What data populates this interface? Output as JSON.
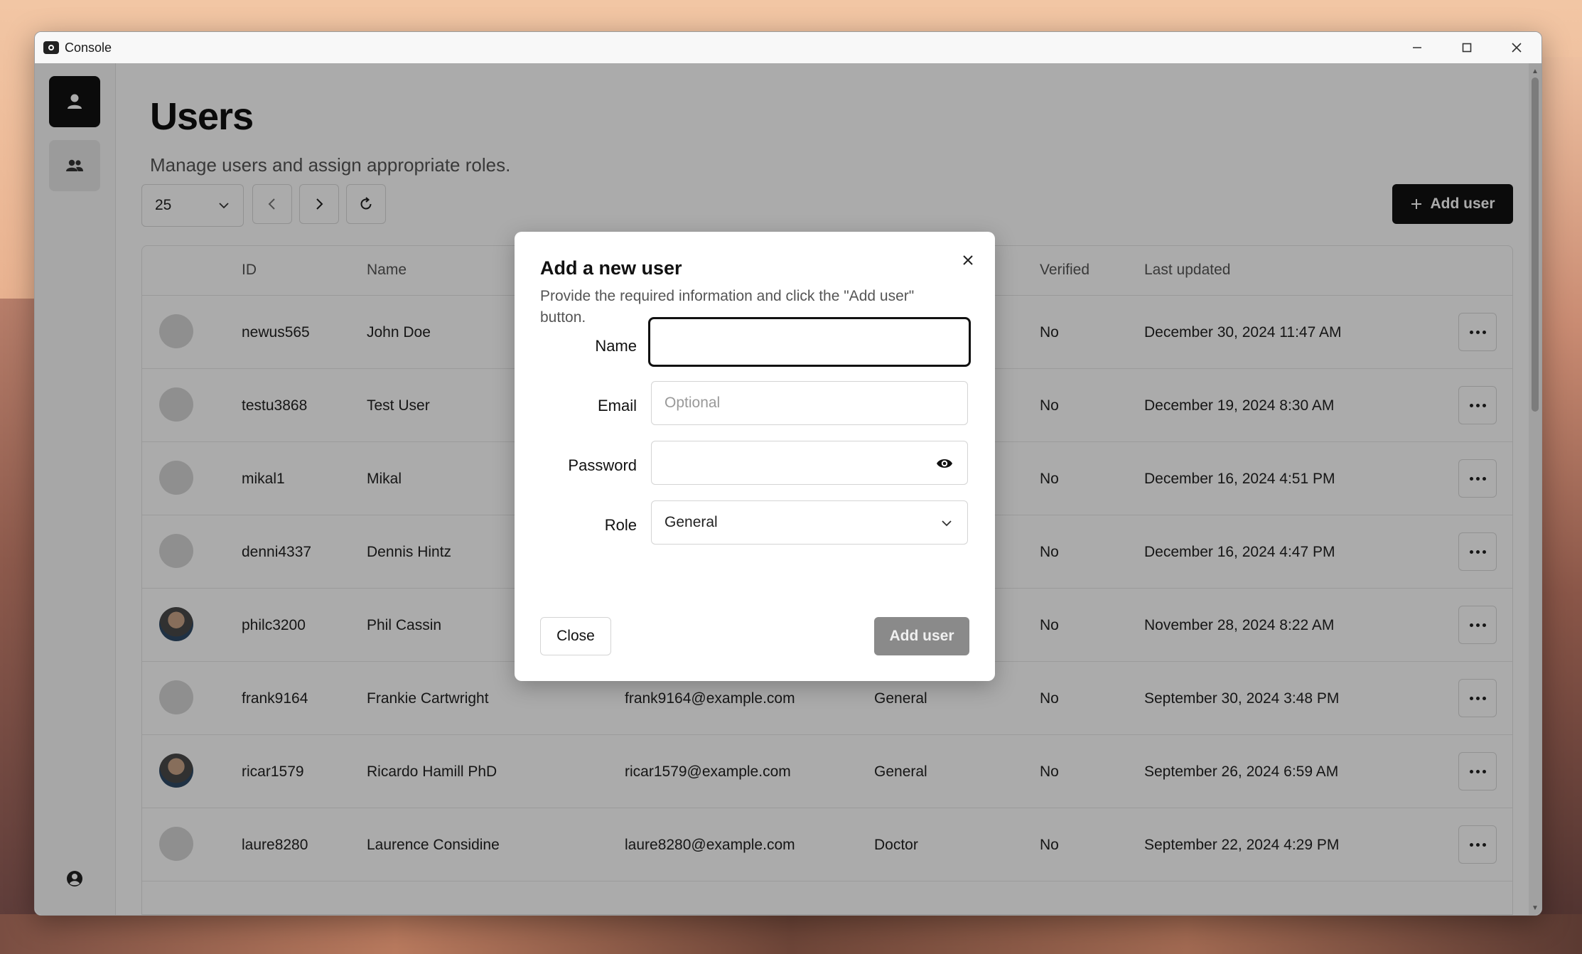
{
  "window": {
    "title": "Console"
  },
  "page": {
    "title": "Users",
    "subtitle": "Manage users and assign appropriate roles."
  },
  "toolbar": {
    "page_size": "25",
    "add_user_label": "Add user"
  },
  "table": {
    "headers": {
      "id": "ID",
      "name": "Name",
      "verified": "Verified",
      "last_updated": "Last updated"
    },
    "rows": [
      {
        "id": "newus565",
        "name": "John Doe",
        "email": "",
        "role": "",
        "verified": "No",
        "last_updated": "December 30, 2024 11:47 AM"
      },
      {
        "id": "testu3868",
        "name": "Test User",
        "email": "",
        "role": "",
        "verified": "No",
        "last_updated": "December 19, 2024 8:30 AM"
      },
      {
        "id": "mikal1",
        "name": "Mikal",
        "email": "",
        "role": "",
        "verified": "No",
        "last_updated": "December 16, 2024 4:51 PM"
      },
      {
        "id": "denni4337",
        "name": "Dennis Hintz",
        "email": "",
        "role": "",
        "verified": "No",
        "last_updated": "December 16, 2024 4:47 PM"
      },
      {
        "id": "philc3200",
        "name": "Phil Cassin",
        "email": "",
        "role": "",
        "verified": "No",
        "last_updated": "November 28, 2024 8:22 AM"
      },
      {
        "id": "frank9164",
        "name": "Frankie Cartwright",
        "email": "frank9164@example.com",
        "role": "General",
        "verified": "No",
        "last_updated": "September 30, 2024 3:48 PM"
      },
      {
        "id": "ricar1579",
        "name": "Ricardo Hamill PhD",
        "email": "ricar1579@example.com",
        "role": "General",
        "verified": "No",
        "last_updated": "September 26, 2024 6:59 AM"
      },
      {
        "id": "laure8280",
        "name": "Laurence Considine",
        "email": "laure8280@example.com",
        "role": "Doctor",
        "verified": "No",
        "last_updated": "September 22, 2024 4:29 PM"
      }
    ]
  },
  "dialog": {
    "title": "Add a new user",
    "description": "Provide the required information and click the \"Add user\" button.",
    "fields": {
      "name_label": "Name",
      "email_label": "Email",
      "email_placeholder": "Optional",
      "password_label": "Password",
      "role_label": "Role",
      "role_value": "General"
    },
    "close_label": "Close",
    "submit_label": "Add user"
  }
}
